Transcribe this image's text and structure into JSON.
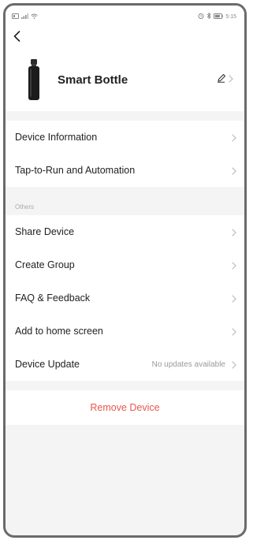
{
  "status_bar": {
    "left_icons": [
      "sim-icon",
      "signal-icon",
      "wifi-icon"
    ],
    "right_icons": [
      "alarm-icon",
      "bluetooth-icon",
      "battery-icon"
    ],
    "time": "5:15"
  },
  "device": {
    "name": "Smart Bottle"
  },
  "main_items": [
    {
      "label": "Device Information"
    },
    {
      "label": "Tap-to-Run and Automation"
    }
  ],
  "others": {
    "header": "Others",
    "items": [
      {
        "label": "Share Device"
      },
      {
        "label": "Create Group"
      },
      {
        "label": "FAQ & Feedback"
      },
      {
        "label": "Add to home screen"
      },
      {
        "label": "Device Update",
        "value": "No updates available"
      }
    ]
  },
  "remove_label": "Remove Device",
  "colors": {
    "remove": "#e8574f",
    "background": "#f4f4f4"
  }
}
